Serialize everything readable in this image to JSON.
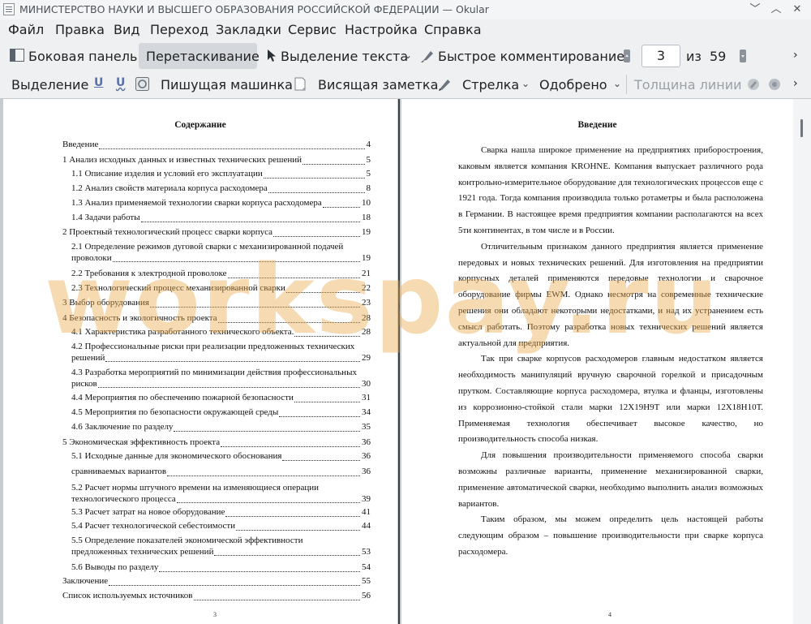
{
  "window": {
    "title": "МИНИСТЕРСТВО НАУКИ И ВЫСШЕГО ОБРАЗОВАНИЯ  РОССИЙСКОЙ ФЕДЕРАЦИИ — Okular"
  },
  "menu": [
    "Файл",
    "Правка",
    "Вид",
    "Переход",
    "Закладки",
    "Сервис",
    "Настройка",
    "Справка"
  ],
  "toolbar1": {
    "sidebar": "Боковая панель",
    "drag": "Перетаскивание",
    "text_select": "Выделение текста",
    "quick_annot": "Быстрое комментирование",
    "page_current": "3",
    "page_of": "из",
    "page_total": "59"
  },
  "toolbar2": {
    "highlight": "Выделение",
    "typewriter": "Пишущая машинка",
    "inline_note": "Висящая заметка",
    "arrow": "Стрелка",
    "approved": "Одобрено",
    "line_width": "Толщина линии"
  },
  "toc": {
    "title": "Содержание",
    "entries": [
      {
        "text": "Введение",
        "page": "4"
      },
      {
        "text": "1 Анализ исходных данных и известных технических решений",
        "page": "5"
      },
      {
        "text": "1.1     Описание изделия и условий его эксплуатации",
        "page": "5"
      },
      {
        "text": "1.2 Анализ свойств материала корпуса расходомера",
        "page": "8"
      },
      {
        "text": "1.3 Анализ применяемой технологии сварки корпуса расходомера",
        "page": "10"
      },
      {
        "text": "1.4 Задачи работы",
        "page": "18"
      },
      {
        "text": "2 Проектный технологический процесс сварки корпуса",
        "page": "19"
      },
      {
        "text": "2.1 Определение режимов дуговой сварки с механизированной подачей",
        "text2": "проволоки",
        "page": "19"
      },
      {
        "text": "2.2 Требования к электродной проволоке",
        "page": "21"
      },
      {
        "text": "2.3 Технологический процесс механизированной сварки",
        "page": "22"
      },
      {
        "text": "3 Выбор оборудования",
        "page": "23"
      },
      {
        "text": "4 Безопасность и экологичность проекта",
        "page": "28"
      },
      {
        "text": "4.1 Характеристика разработанного технического объекта.",
        "page": "28"
      },
      {
        "text": "4.2 Профессиональные риски при реализации предложенных технических",
        "text2": "решений",
        "page": "29"
      },
      {
        "text": "4.3 Разработка мероприятий по минимизации действия  профессиональных",
        "text2": "рисков",
        "page": "30"
      },
      {
        "text": "4.4 Мероприятия по обеспечению пожарной безопасности",
        "page": "31"
      },
      {
        "text": "4.5 Мероприятия по безопасности окружающей среды",
        "page": "34"
      },
      {
        "text": "4.6 Заключение по разделу",
        "page": "35"
      },
      {
        "text": "5 Экономическая эффективность проекта",
        "page": "36"
      },
      {
        "text": "5.1 Исходные данные для экономического обоснования",
        "page": "36"
      },
      {
        "text": "сравниваемых вариантов",
        "page": "36"
      },
      {
        "text": "5.2 Расчет нормы штучного времени на изменяющиеся операции",
        "text2": "технологического процесса",
        "page": "39"
      },
      {
        "text": "5.3 Расчет затрат на новое оборудование",
        "page": "41"
      },
      {
        "text": "5.4 Расчет технологической себестоимости",
        "page": "44"
      },
      {
        "text": "5.5 Определение показателей экономической эффективности",
        "text2": "предложенных технических решений",
        "page": "53"
      },
      {
        "text": "5.6 Выводы по разделу",
        "page": "54"
      },
      {
        "text": "Заключение",
        "page": "55"
      },
      {
        "text": "Список используемых источников",
        "page": "56"
      }
    ],
    "page_number": "3"
  },
  "intro": {
    "title": "Введение",
    "paragraphs": [
      "Сварка нашла широкое применение на предприятиях приборостроения, каковым является компания KROHNE. Компания выпускает различного рода контрольно-измерительное оборудование для технологических процессов еще с 1921 года. Тогда компания производила только ротаметры и была расположена в Германии. В настоящее время предприятия компании располагаются на всех 5ти континентах, в том числе и в России.",
      "Отличительным признаком данного предприятия является применение передовых и новых технических решений. Для изготовления на предприятии корпусных деталей применяются передовые технологии и сварочное оборудование фирмы EWM. Однако несмотря на современные технические решения они обладают некоторыми недостатками, и над их устранением есть смысл работать. Поэтому разработка новых технических решений является актуальной для предприятия.",
      "Так при сварке корпусов расходомеров главным недостатком является необходимость манипуляций вручную сварочной горелкой и присадочным прутком. Составляющие корпуса расходомера, втулка и фланцы, изготовлены из коррозионно-стойкой стали марки 12Х19Н9Т или марки 12Х18Н10Т. Применяемая технология обеспечивает высокое качество, но производительность способа низкая.",
      "Для повышения производительности применяемого способа сварки возможны различные варианты, применение механизированной сварки, применение автоматической сварки, необходимо выполнить анализ возможных вариантов.",
      "Таким образом, мы можем определить цель настоящей работы следующим образом – повышение производительности при сварке корпуса расходомера."
    ],
    "page_number": "4"
  },
  "watermark": "workspay.ru"
}
